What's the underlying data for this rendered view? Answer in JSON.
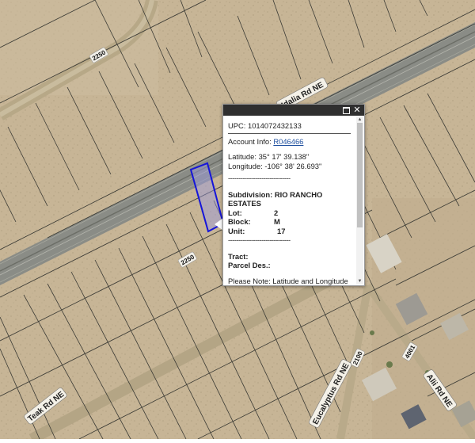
{
  "map": {
    "road_labels": {
      "idalia": "Idalia Rd NE",
      "teak": "Teak Rd NE",
      "eucalyptus": "Eucalyptus Rd NE",
      "alii": "Alii Rd NE"
    },
    "number_labels": {
      "n_top": "2250",
      "n_mid": "2250",
      "n_bottom": "2100",
      "n_right": "4001"
    },
    "colors": {
      "desert": "#c7b596",
      "highway": "#8a8c86",
      "parcel_lines": "#3a3a34",
      "selected_parcel": "#1515d9"
    }
  },
  "popup": {
    "upc": "UPC: 1014072432133",
    "account_label": "Account Info:",
    "account_link": "R046466",
    "latitude": "Latitude: 35° 17' 39.138\"",
    "longitude": "Longitude: -106° 38' 26.693\"",
    "separator": "------------------------------",
    "subdivision_line1": "Subdivision: RIO RANCHO",
    "subdivision_line2": "ESTATES",
    "lot_label": "Lot:",
    "lot_value": "2",
    "block_label": "Block:",
    "block_value": "M",
    "unit_label": "Unit:",
    "unit_value": "17",
    "tract": "Tract:",
    "parcel_des": "Parcel Des.:",
    "note": "Please Note: Latitude and Longitude is the approximate center of the parcel shown"
  }
}
